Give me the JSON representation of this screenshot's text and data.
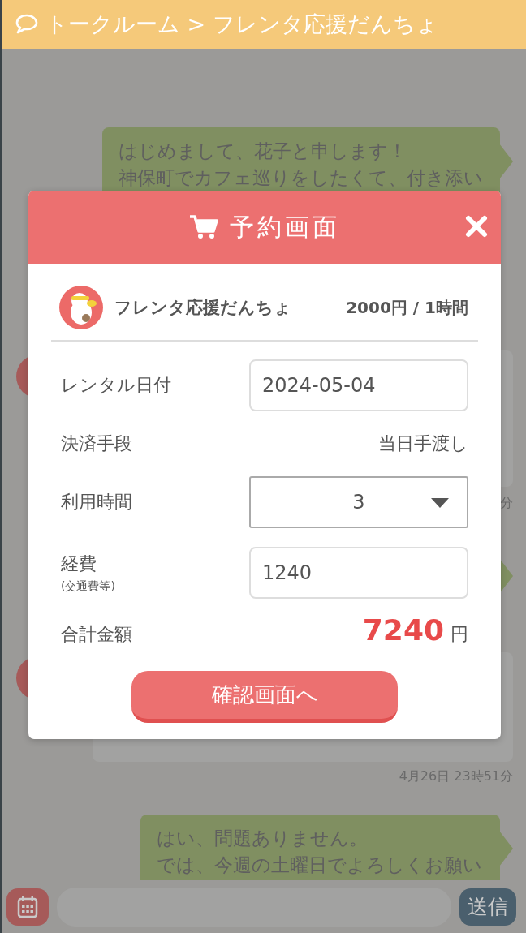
{
  "header": {
    "title": "トークルーム > フレンタ応援だんちょ"
  },
  "messages": [
    {
      "kind": "sent",
      "lines": [
        "はじめまして、花子と申します！",
        "神保町でカフェ巡りをしたくて、付き添い"
      ]
    },
    {
      "kind": "received"
    },
    {
      "kind": "time",
      "text": "分"
    },
    {
      "kind": "sent"
    },
    {
      "kind": "received"
    },
    {
      "kind": "time",
      "text": "4月26日 23時51分"
    },
    {
      "kind": "sent",
      "lines": [
        "はい、問題ありません。",
        "では、今週の土曜日でよろしくお願い"
      ]
    }
  ],
  "composer": {
    "send_button": "送信"
  },
  "booking": {
    "title": "予約画面",
    "host": {
      "name": "フレンタ応援だんちょ",
      "price": "2000円 / 1時間"
    },
    "fields": [
      {
        "kind": "input",
        "label": "レンタル日付",
        "value": "2024-05-04"
      },
      {
        "kind": "text",
        "label": "決済手段",
        "value": "当日手渡し"
      },
      {
        "kind": "select",
        "label": "利用時間",
        "value": "3"
      },
      {
        "kind": "input",
        "label": "経費",
        "note": "(交通費等)",
        "value": "1240"
      }
    ],
    "total": {
      "label": "合計金額",
      "amount": "7240",
      "unit": "円"
    },
    "confirm_button": "確認画面へ"
  }
}
